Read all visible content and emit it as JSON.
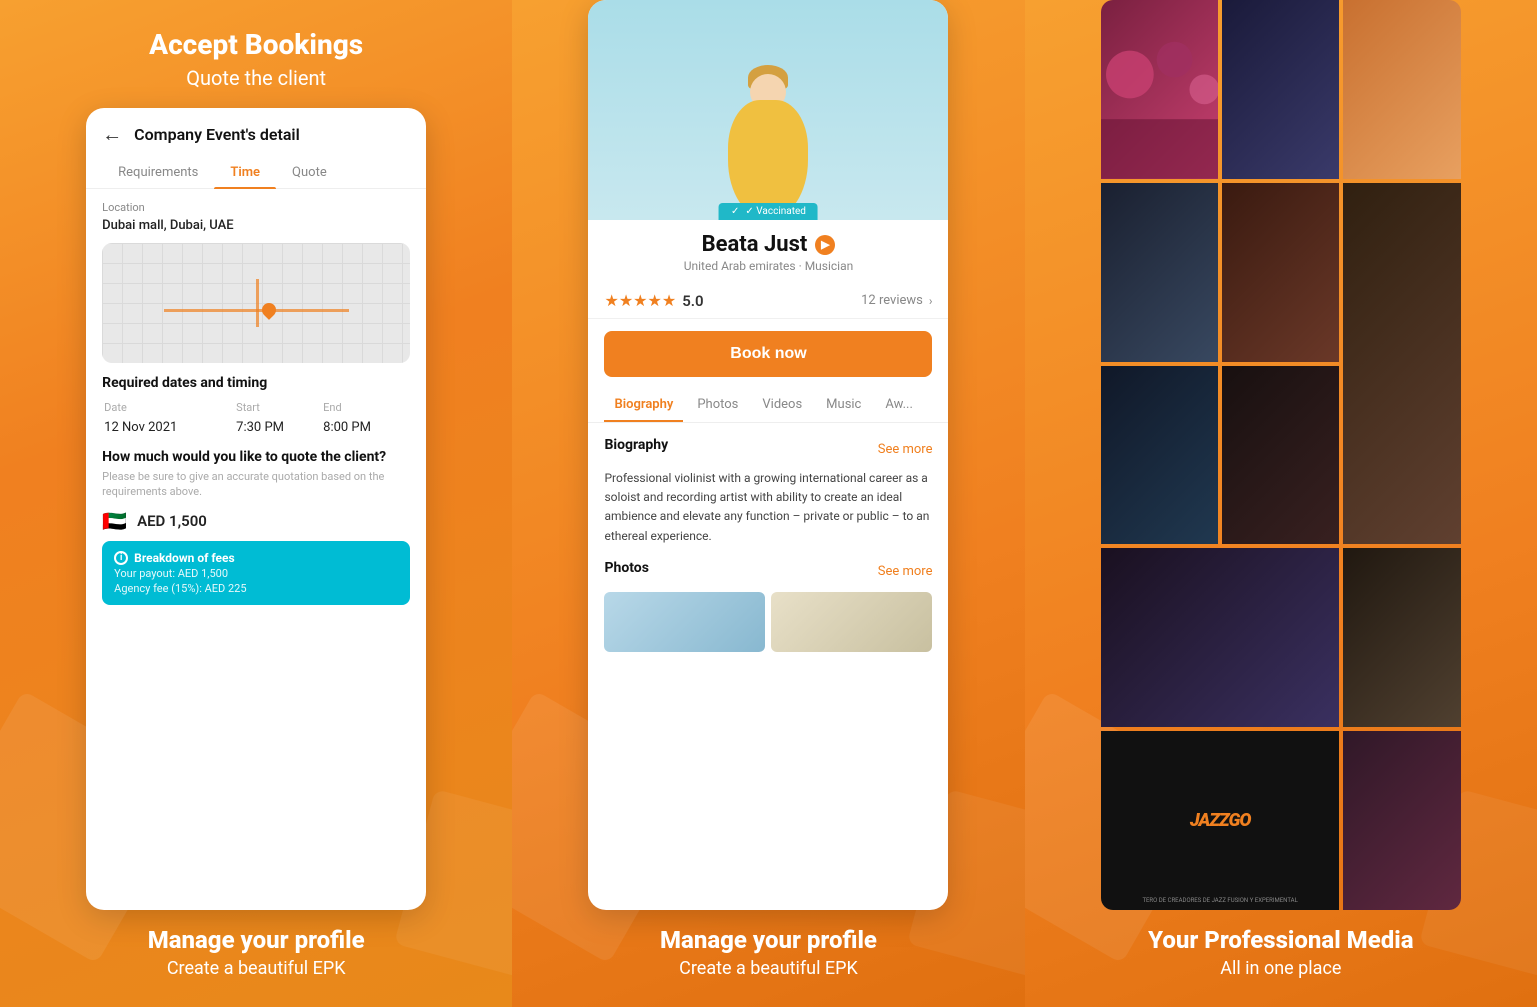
{
  "panel1": {
    "heading": "Accept Bookings",
    "subheading": "Quote the client",
    "card": {
      "nav_title": "Company Event's detail",
      "back_label": "←",
      "tabs": [
        "Requirements",
        "Time",
        "Quote"
      ],
      "active_tab": "Time",
      "location_label": "Location",
      "location_value": "Dubai mall, Dubai, UAE",
      "section_dates": "Required dates and timing",
      "table_headers": [
        "Date",
        "Start",
        "End"
      ],
      "table_row": [
        "12 Nov 2021",
        "7:30 PM",
        "8:00 PM"
      ],
      "quote_question": "How much would you like to quote the client?",
      "quote_note": "Please be sure to give an accurate quotation based on the requirements above.",
      "amount": "AED 1,500",
      "breakdown_title": "Breakdown of fees",
      "breakdown_line1": "Your payout: AED 1,500",
      "breakdown_line2": "Agency fee (15%): AED 225"
    },
    "footer": {
      "main": "Manage your profile",
      "sub": "Create a beautiful EPK"
    }
  },
  "panel2": {
    "vaccinated_badge": "✓ Vaccinated",
    "artist_name": "Beata Just",
    "artist_location": "United Arab emirates · Musician",
    "rating": "5.0",
    "reviews": "12 reviews",
    "book_button": "Book now",
    "tabs": [
      "Biography",
      "Photos",
      "Videos",
      "Music",
      "Aw..."
    ],
    "active_tab": "Biography",
    "bio_heading": "Biography",
    "bio_see_more": "See more",
    "bio_text": "Professional violinist with a growing international career as a soloist and recording artist with ability to create an ideal ambience and elevate any function – private or public – to an ethereal experience.",
    "photos_heading": "Photos",
    "photos_see_more": "See more",
    "footer": {
      "main": "Manage your profile",
      "sub": "Create a beautiful EPK"
    }
  },
  "panel3": {
    "heading": "Your Professional Media",
    "subheading": "All in one place",
    "jazzgo_text": "JAZZGO",
    "jazzgo_sub": "TERO DE CREADORES DE JAZZ FUSION Y EXPERIMENTAL"
  }
}
